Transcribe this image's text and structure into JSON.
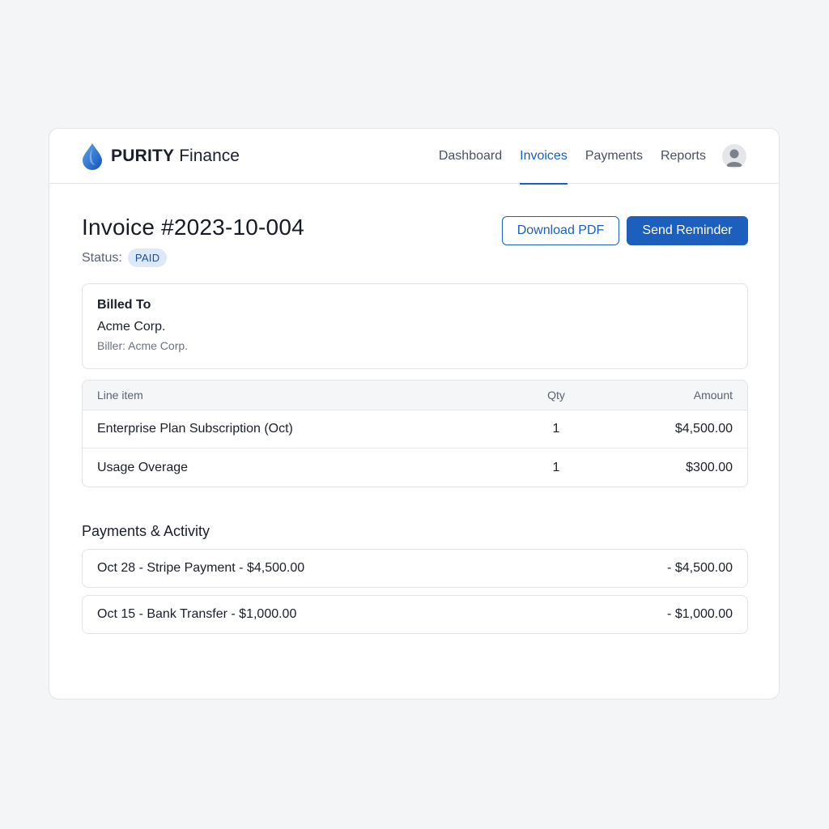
{
  "brand": {
    "name_bold": "PURITY",
    "name_light": "Finance",
    "logo_icon": "droplet-icon",
    "accent_color": "#1d5fbd"
  },
  "nav": {
    "items": [
      {
        "label": "Dashboard",
        "active": false
      },
      {
        "label": "Invoices",
        "active": true
      },
      {
        "label": "Payments",
        "active": false
      },
      {
        "label": "Reports",
        "active": false
      }
    ],
    "avatar_icon": "user-avatar-icon"
  },
  "invoice": {
    "title": "Invoice #2023-10-004",
    "status_label": "Status:",
    "status_value": "PAID",
    "status_color": "#dbe9fb"
  },
  "actions": {
    "download_label": "Download PDF",
    "reminder_label": "Send Reminder"
  },
  "billed": {
    "heading": "Billed To",
    "name": "Acme Corp.",
    "sub": "Biller: Acme Corp."
  },
  "line_items": {
    "headers": {
      "item": "Line item",
      "qty": "Qty",
      "amount": "Amount"
    },
    "rows": [
      {
        "item": "Enterprise Plan Subscription (Oct)",
        "qty": "1",
        "amount": "$4,500.00"
      },
      {
        "item": "Usage Overage",
        "qty": "1",
        "amount": "$300.00"
      }
    ]
  },
  "payments": {
    "title": "Payments & Activity",
    "rows": [
      {
        "label": "Oct 28 - Stripe Payment - $4,500.00",
        "amount": "- $4,500.00"
      },
      {
        "label": "Oct 15 - Bank Transfer - $1,000.00",
        "amount": "- $1,000.00"
      }
    ]
  }
}
